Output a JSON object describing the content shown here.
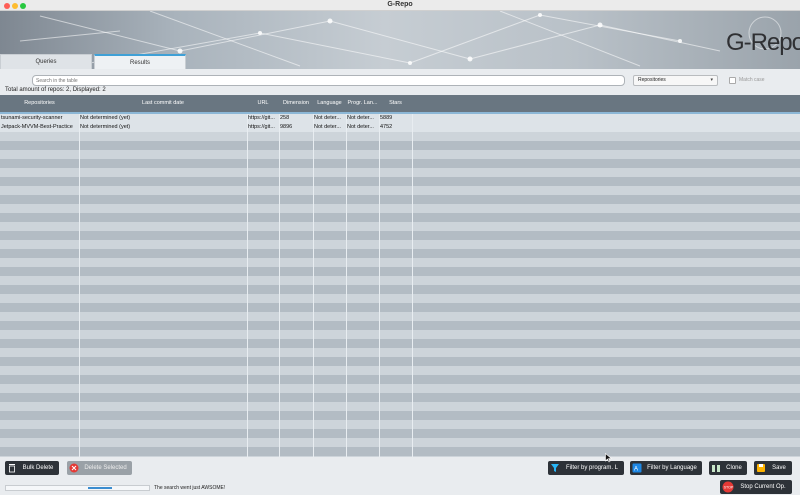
{
  "window": {
    "title": "G-Repo"
  },
  "brand": {
    "logo_text": "G-Repo"
  },
  "tabs": [
    {
      "label": "Queries",
      "active": false
    },
    {
      "label": "Results",
      "active": true
    }
  ],
  "search": {
    "placeholder": "Search in the table",
    "value": ""
  },
  "filter_combo": {
    "selected": "Repositories"
  },
  "checkbox": {
    "label": "Match case",
    "checked": false
  },
  "summary": {
    "text": "Total amount of repos: 2, Displayed: 2"
  },
  "table": {
    "columns": [
      "Repositories",
      "Last commit date",
      "URL",
      "Dimension",
      "Language",
      "Progr. Lan...",
      "Stars"
    ],
    "rows": [
      [
        "tsunami-security-scanner",
        "Not determined (yet)",
        "https://git...",
        "258",
        "Not deter...",
        "Not deter...",
        "5889"
      ],
      [
        "Jetpack-MVVM-Best-Practice",
        "Not determined (yet)",
        "https://git...",
        "9896",
        "Not deter...",
        "Not deter...",
        "4752"
      ]
    ]
  },
  "buttons": {
    "bulk_delete": "Bulk Delete",
    "delete_selected": "Delete Selected",
    "filter_prog": "Filter by program. L",
    "filter_lang": "Filter by Language",
    "clone": "Clone",
    "save": "Save",
    "stop": "Stop Current Op."
  },
  "status": {
    "message": "The search went just AWSOME!",
    "progress_indeterminate": true
  },
  "colors": {
    "header_bg": "#697681",
    "accent": "#3b8dd0",
    "row_a": "#cdd4da",
    "row_b": "#b3bcc4",
    "button_bg": "#2d3238"
  }
}
